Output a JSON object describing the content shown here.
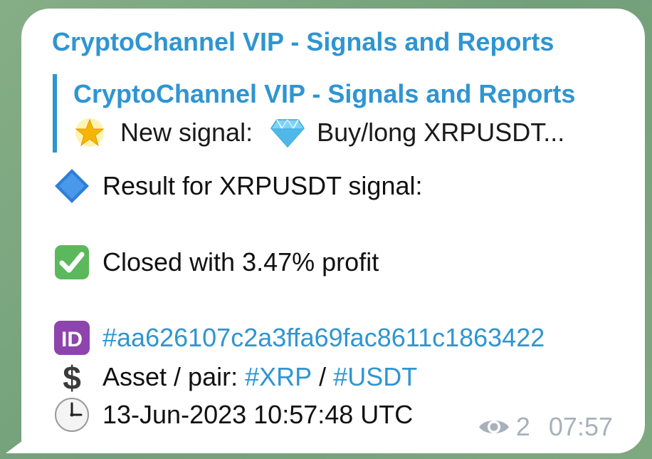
{
  "message": {
    "sender": "CryptoChannel VIP - Signals and Reports",
    "reply": {
      "title": "CryptoChannel VIP - Signals and Reports",
      "new_signal_label": "New signal:",
      "signal_text": "Buy/long XRPUSDT..."
    },
    "result_line": "Result for XRPUSDT signal:",
    "closed_line": "Closed with 3.47% profit",
    "id_hashtag": "#aa626107c2a3ffa69fac8611c1863422",
    "asset_label": "Asset / pair:",
    "asset_tag": "#XRP",
    "asset_sep": "/",
    "pair_tag": "#USDT",
    "timestamp": "13-Jun-2023 10:57:48 UTC",
    "views": "2",
    "time": "07:57"
  },
  "icons": {
    "star": "glowing-star-icon",
    "gem": "gem-stone-icon",
    "diamond": "blue-diamond-icon",
    "check": "check-mark-button-icon",
    "id": "id-button-icon",
    "dollar": "heavy-dollar-sign-icon",
    "clock": "clock-icon",
    "eye": "eye-icon"
  },
  "colors": {
    "link": "#2f95d1",
    "meta": "#a7b1bb",
    "check_green": "#5cb85c",
    "id_purple": "#8e44ad",
    "diamond_blue": "#2e7fd8"
  }
}
